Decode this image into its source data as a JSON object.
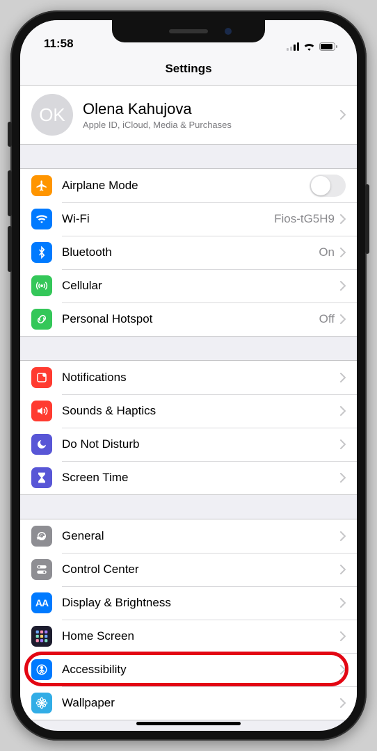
{
  "status": {
    "time": "11:58"
  },
  "header": {
    "title": "Settings"
  },
  "profile": {
    "initials": "OK",
    "name": "Olena Kahujova",
    "subtitle": "Apple ID, iCloud, Media & Purchases"
  },
  "groups": [
    {
      "items": [
        {
          "id": "airplane",
          "label": "Airplane Mode",
          "icon": "airplane-icon",
          "color": "ic-orange",
          "control": "toggle",
          "value": "off"
        },
        {
          "id": "wifi",
          "label": "Wi-Fi",
          "icon": "wifi-icon",
          "color": "ic-blue",
          "control": "detail",
          "detail": "Fios-tG5H9"
        },
        {
          "id": "bluetooth",
          "label": "Bluetooth",
          "icon": "bluetooth-icon",
          "color": "ic-blue",
          "control": "detail",
          "detail": "On"
        },
        {
          "id": "cellular",
          "label": "Cellular",
          "icon": "antenna-icon",
          "color": "ic-green",
          "control": "chevron"
        },
        {
          "id": "hotspot",
          "label": "Personal Hotspot",
          "icon": "link-icon",
          "color": "ic-green",
          "control": "detail",
          "detail": "Off"
        }
      ]
    },
    {
      "items": [
        {
          "id": "notifications",
          "label": "Notifications",
          "icon": "bell-icon",
          "color": "ic-red",
          "control": "chevron"
        },
        {
          "id": "sounds",
          "label": "Sounds & Haptics",
          "icon": "speaker-icon",
          "color": "ic-red",
          "control": "chevron"
        },
        {
          "id": "dnd",
          "label": "Do Not Disturb",
          "icon": "moon-icon",
          "color": "ic-indigo",
          "control": "chevron"
        },
        {
          "id": "screentime",
          "label": "Screen Time",
          "icon": "hourglass-icon",
          "color": "ic-indigo",
          "control": "chevron"
        }
      ]
    },
    {
      "items": [
        {
          "id": "general",
          "label": "General",
          "icon": "gear-icon",
          "color": "ic-gray",
          "control": "chevron"
        },
        {
          "id": "controlcenter",
          "label": "Control Center",
          "icon": "switches-icon",
          "color": "ic-gray",
          "control": "chevron"
        },
        {
          "id": "display",
          "label": "Display & Brightness",
          "icon": "aa-icon",
          "color": "ic-blue",
          "control": "chevron"
        },
        {
          "id": "homescreen",
          "label": "Home Screen",
          "icon": "grid-icon",
          "color": "ic-gradient",
          "control": "chevron"
        },
        {
          "id": "accessibility",
          "label": "Accessibility",
          "icon": "person-icon",
          "color": "ic-blue",
          "control": "chevron",
          "highlighted": true
        },
        {
          "id": "wallpaper",
          "label": "Wallpaper",
          "icon": "flower-icon",
          "color": "ic-cyan",
          "control": "chevron"
        }
      ]
    }
  ]
}
